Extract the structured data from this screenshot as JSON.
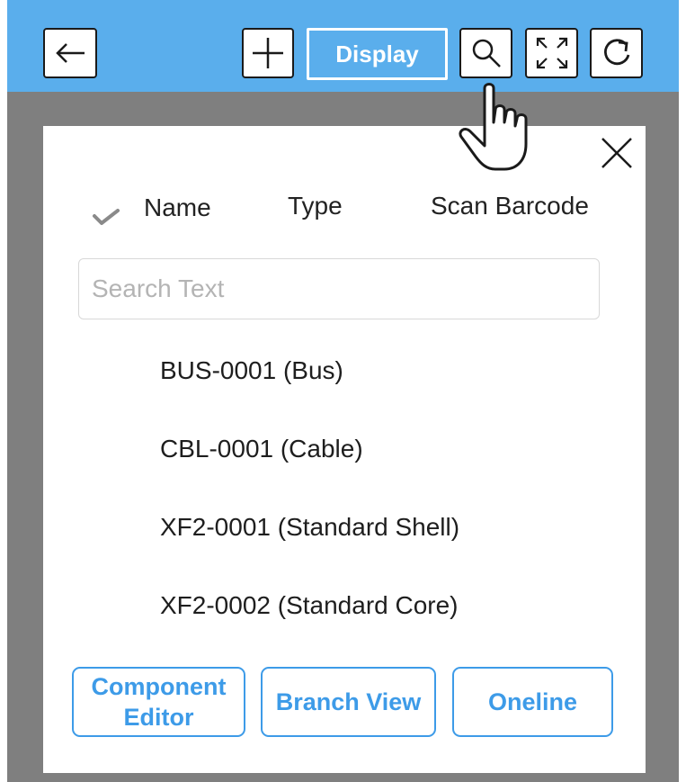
{
  "toolbar": {
    "display_label": "Display",
    "icons": [
      "back-arrow-icon",
      "plus-icon",
      "search-icon",
      "expand-icon",
      "refresh-icon"
    ]
  },
  "search_options": {
    "selected": "Name",
    "name_label": "Name",
    "type_label": "Type",
    "scan_label": "Scan Barcode"
  },
  "search": {
    "placeholder": "Search Text",
    "value": ""
  },
  "results": [
    "BUS-0001 (Bus)",
    "CBL-0001 (Cable)",
    "XF2-0001 (Standard Shell)",
    "XF2-0002 (Standard Core)"
  ],
  "buttons": {
    "component_editor": "Component Editor",
    "branch_view": "Branch View",
    "oneline": "Oneline"
  },
  "colors": {
    "toolbar_bg": "#5aaeec",
    "accent": "#3d9be8",
    "backdrop": "#7f7f7f"
  }
}
